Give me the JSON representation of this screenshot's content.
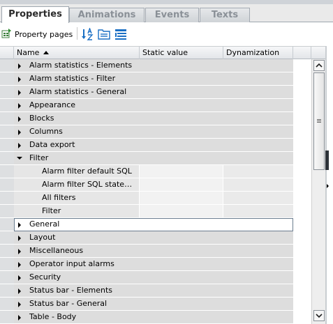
{
  "tabs": [
    {
      "label": "Properties",
      "active": true
    },
    {
      "label": "Animations",
      "active": false
    },
    {
      "label": "Events",
      "active": false
    },
    {
      "label": "Texts",
      "active": false
    }
  ],
  "toolbar": {
    "property_pages_label": "Property pages",
    "icons": [
      "property-pages-icon",
      "sort-alphabetical-icon",
      "view-categories-icon",
      "view-list-icon"
    ]
  },
  "table": {
    "columns": [
      {
        "label": "Name",
        "sorted": "ascending"
      },
      {
        "label": "Static value"
      },
      {
        "label": "Dynamization"
      }
    ],
    "rows": [
      {
        "type": "category",
        "label": "Alarm statistics - Elements",
        "expanded": false
      },
      {
        "type": "category",
        "label": "Alarm statistics - Filter",
        "expanded": false
      },
      {
        "type": "category",
        "label": "Alarm statistics - General",
        "expanded": false
      },
      {
        "type": "category",
        "label": "Appearance",
        "expanded": false
      },
      {
        "type": "category",
        "label": "Blocks",
        "expanded": false
      },
      {
        "type": "category",
        "label": "Columns",
        "expanded": false
      },
      {
        "type": "category",
        "label": "Data export",
        "expanded": false
      },
      {
        "type": "category",
        "label": "Filter",
        "expanded": true
      },
      {
        "type": "property",
        "label": "Alarm filter default SQL",
        "value": "",
        "dynamization": ""
      },
      {
        "type": "property",
        "label": "Alarm filter SQL statem…",
        "value": "",
        "dynamization": ""
      },
      {
        "type": "property",
        "label": "All filters",
        "value": "",
        "dynamization": ""
      },
      {
        "type": "property",
        "label": "Filter",
        "value": "",
        "dynamization": ""
      },
      {
        "type": "category",
        "label": "General",
        "expanded": false,
        "selected": true
      },
      {
        "type": "category",
        "label": "Layout",
        "expanded": false
      },
      {
        "type": "category",
        "label": "Miscellaneous",
        "expanded": false
      },
      {
        "type": "category",
        "label": "Operator input alarms",
        "expanded": false
      },
      {
        "type": "category",
        "label": "Security",
        "expanded": false
      },
      {
        "type": "category",
        "label": "Status bar - Elements",
        "expanded": false
      },
      {
        "type": "category",
        "label": "Status bar - General",
        "expanded": false
      },
      {
        "type": "category",
        "label": "Table - Body",
        "expanded": false
      }
    ]
  },
  "colors": {
    "accent": "#1a6fc4",
    "selection_border": "#6b7d8f",
    "category_bg": "#dddddd"
  }
}
